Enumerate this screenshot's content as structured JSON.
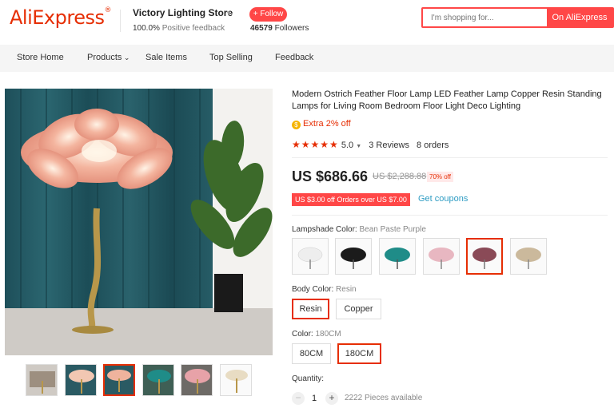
{
  "header": {
    "logo": "AliExpress",
    "store_name": "Victory Lighting Store",
    "feedback_value": "100.0%",
    "feedback_label": "Positive feedback",
    "follow_label": "+ Follow",
    "followers_count": "46579",
    "followers_label": "Followers",
    "search_placeholder": "I'm shopping for...",
    "search_button": "On AliExpress"
  },
  "nav": {
    "items": [
      "Store Home",
      "Products",
      "Sale Items",
      "Top Selling",
      "Feedback"
    ]
  },
  "product": {
    "title": "Modern Ostrich Feather Floor Lamp LED Feather Lamp Copper Resin Standing Lamps for Living Room Bedroom Floor Light Deco Lighting",
    "extra_discount": "Extra 2% off",
    "rating": "5.0",
    "reviews": "3 Reviews",
    "orders": "8 orders",
    "price": "US $686.66",
    "original_price": "US $2,288.88",
    "discount": "70% off",
    "coupon": "US $3.00 off Orders over US $7.00",
    "get_coupons": "Get coupons"
  },
  "options": {
    "lampshade_label": "Lampshade Color:",
    "lampshade_selected": "Bean Paste Purple",
    "lampshade_colors": [
      "#f0eeee",
      "#1b1b1b",
      "#1f8c88",
      "#e8b7c1",
      "#8a4a57",
      "#cbb99c"
    ],
    "body_label": "Body Color:",
    "body_selected": "Resin",
    "body_values": [
      "Resin",
      "Copper"
    ],
    "size_label": "Color:",
    "size_selected": "180CM",
    "size_values": [
      "80CM",
      "180CM"
    ],
    "quantity_label": "Quantity:",
    "quantity_value": "1",
    "available": "2222 Pieces available"
  },
  "colors": {
    "brand": "#e62e04",
    "accent": "#ff4747",
    "link": "#2e9cc3"
  }
}
